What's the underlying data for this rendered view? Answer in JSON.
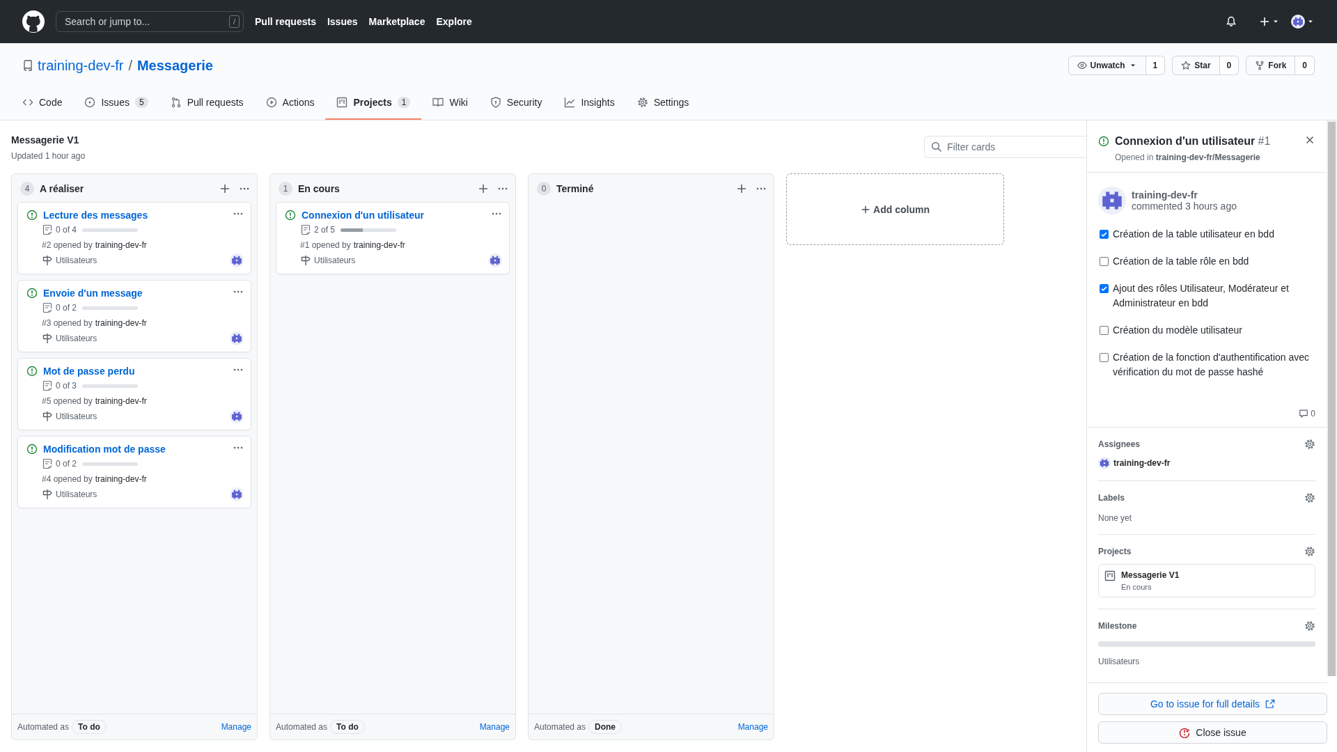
{
  "header": {
    "search": {
      "placeholder": "Search or jump to...",
      "shortcut": "/"
    },
    "nav": [
      "Pull requests",
      "Issues",
      "Marketplace",
      "Explore"
    ]
  },
  "repo": {
    "owner": "training-dev-fr",
    "separator": "/",
    "name": "Messagerie",
    "actions": [
      {
        "label": "Unwatch",
        "count": "1",
        "dropdown": true
      },
      {
        "label": "Star",
        "count": "0",
        "dropdown": false
      },
      {
        "label": "Fork",
        "count": "0",
        "dropdown": false
      }
    ]
  },
  "tabs": [
    {
      "label": "Code",
      "selected": false
    },
    {
      "label": "Issues",
      "count": "5",
      "selected": false
    },
    {
      "label": "Pull requests",
      "selected": false
    },
    {
      "label": "Actions",
      "selected": false
    },
    {
      "label": "Projects",
      "count": "1",
      "selected": true
    },
    {
      "label": "Wiki",
      "selected": false
    },
    {
      "label": "Security",
      "selected": false
    },
    {
      "label": "Insights",
      "selected": false
    },
    {
      "label": "Settings",
      "selected": false
    }
  ],
  "project": {
    "title": "Messagerie V1",
    "updated": "Updated 1 hour ago",
    "filter": {
      "placeholder": "Filter cards"
    }
  },
  "columns": [
    {
      "count": "4",
      "name": "A réaliser",
      "automated": "Automated as",
      "automation": "To do",
      "manage": "Manage",
      "cards": [
        {
          "title": "Lecture des messages",
          "progress": "0 of 4",
          "level": 0,
          "number": "#2",
          "opened_by": "opened by",
          "author": "training-dev-fr",
          "milestone": "Utilisateurs"
        },
        {
          "title": "Envoie d'un message",
          "progress": "0 of 2",
          "level": 0,
          "number": "#3",
          "opened_by": "opened by",
          "author": "training-dev-fr",
          "milestone": "Utilisateurs"
        },
        {
          "title": "Mot de passe perdu",
          "progress": "0 of 3",
          "level": 0,
          "number": "#5",
          "opened_by": "opened by",
          "author": "training-dev-fr",
          "milestone": "Utilisateurs"
        },
        {
          "title": "Modification mot de passe",
          "progress": "0 of 2",
          "level": 0,
          "number": "#4",
          "opened_by": "opened by",
          "author": "training-dev-fr",
          "milestone": "Utilisateurs"
        }
      ]
    },
    {
      "count": "1",
      "name": "En cours",
      "automated": "Automated as",
      "automation": "To do",
      "manage": "Manage",
      "cards": [
        {
          "title": "Connexion d'un utilisateur",
          "progress": "2 of 5",
          "level": 0.4,
          "number": "#1",
          "opened_by": "opened by",
          "author": "training-dev-fr",
          "milestone": "Utilisateurs"
        }
      ]
    },
    {
      "count": "0",
      "name": "Terminé",
      "automated": "Automated as",
      "automation": "Done",
      "manage": "Manage"
    }
  ],
  "add_column": "Add column",
  "panel": {
    "title": "Connexion d'un utilisateur",
    "number": "#1",
    "opened_in": "Opened in **training-dev-fr/Messagerie**",
    "comment": {
      "author": "training-dev-fr",
      "time": "commented 3 hours ago",
      "comment_count": "0",
      "tasks": [
        {
          "text": "Création de la table utilisateur en bdd",
          "checked": true
        },
        {
          "text": "Création de la table rôle en bdd",
          "checked": false
        },
        {
          "text": "Ajout des rôles Utilisateur, Modérateur et Administrateur en bdd",
          "checked": true
        },
        {
          "text": "Création du modèle utilisateur",
          "checked": false
        },
        {
          "text": "Création de la fonction d'authentification avec vérification du mot de passe hashé",
          "checked": false
        }
      ]
    },
    "assignees": {
      "heading": "Assignees",
      "people": [
        "training-dev-fr"
      ]
    },
    "labels": {
      "heading": "Labels",
      "empty": "None yet"
    },
    "projects": {
      "heading": "Projects",
      "items": [
        {
          "name": "Messagerie V1",
          "column": "En cours"
        }
      ]
    },
    "milestone": {
      "heading": "Milestone",
      "level": 0,
      "name": "Utilisateurs"
    },
    "buttons": [
      {
        "label": "Go to issue for full details",
        "kind": "link"
      },
      {
        "label": "Close issue",
        "kind": "close"
      }
    ]
  }
}
